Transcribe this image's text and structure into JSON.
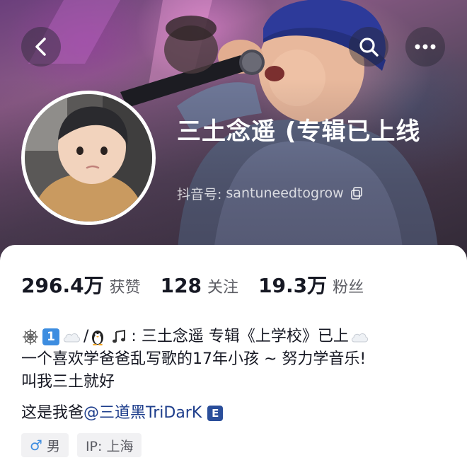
{
  "header": {
    "nickname": "三土念遥 (专辑已上线",
    "douyin_id_label": "抖音号:",
    "douyin_id": "santuneedtogrow"
  },
  "icons": {
    "back": "back-chevron-icon",
    "search": "search-icon",
    "more": "more-dots-icon",
    "copy": "copy-icon",
    "gender": "male-icon"
  },
  "stats": [
    {
      "value": "296.4万",
      "label": "获赞"
    },
    {
      "value": "128",
      "label": "关注"
    },
    {
      "value": "19.3万",
      "label": "粉丝"
    }
  ],
  "bio": {
    "line1_prefix_emoji": [
      "🕸",
      "1",
      "☁",
      "🐧",
      "🎵"
    ],
    "line1_sep": "/",
    "line1_text": ": 三土念遥 专辑《上学校》已上",
    "line1_suffix_emoji": "☁",
    "line2": "一个喜欢学爸爸乱写歌的17年小孩 ~ 努力学音乐!",
    "line3": "叫我三土就好"
  },
  "dad": {
    "prefix": "这是我爸",
    "mention": "@三道黑TriDarK",
    "badge": "E"
  },
  "tags": {
    "gender": "男",
    "gender_symbol": "♂",
    "ip": "IP: 上海"
  },
  "colors": {
    "mention": "#1e3e8c",
    "badge": "#2a4e9a",
    "gender_symbol": "#3d8de0"
  }
}
